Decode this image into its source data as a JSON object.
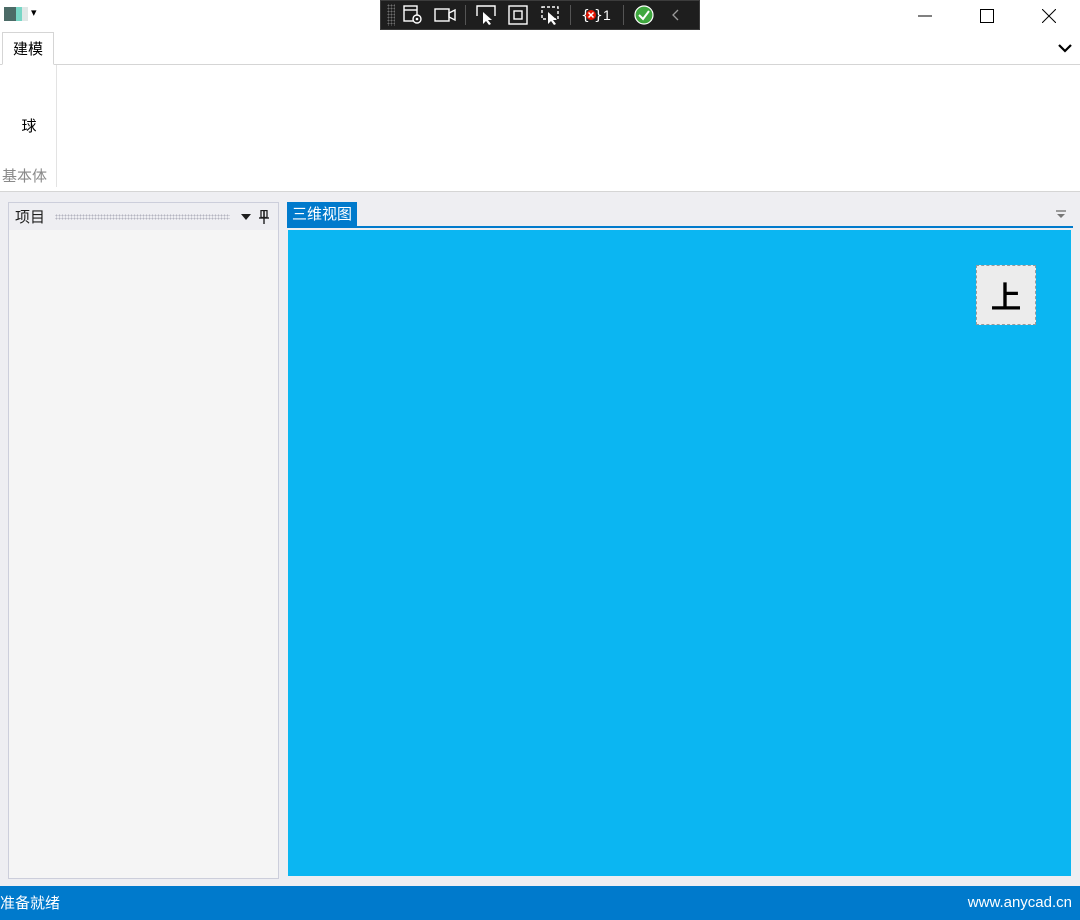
{
  "titlebar": {
    "qat_dropdown_glyph": "▾",
    "debug_toolbar": {
      "icons": [
        "live-visual-tree-icon",
        "record-icon",
        "select-element-icon",
        "display-layout-adorners-icon",
        "track-focus-icon",
        "binding-failures-icon",
        "xaml-hot-reload-icon",
        "collapse-icon"
      ],
      "binding_failures_count": "1"
    },
    "window_buttons": [
      "minimize-icon",
      "maximize-icon",
      "close-icon"
    ]
  },
  "ribbon": {
    "tabs": [
      {
        "label": "建模",
        "selected": true
      }
    ],
    "collapse_icon": "chevron-down-icon",
    "groups": [
      {
        "label": "基本体",
        "buttons": [
          {
            "label": "球"
          }
        ]
      }
    ]
  },
  "project_panel": {
    "title": "项目",
    "icons": [
      "dropdown-arrow-icon",
      "pin-icon"
    ]
  },
  "document_tabs": {
    "tabs": [
      {
        "label": "三维视图",
        "active": true
      }
    ],
    "dropdown_icon": "tab-list-dropdown-icon"
  },
  "viewport": {
    "background_color": "#0bb6f2",
    "view_cube_label": "上"
  },
  "statusbar": {
    "status": "准备就绪",
    "url": "www.anycad.cn",
    "background_color": "#007acc"
  }
}
